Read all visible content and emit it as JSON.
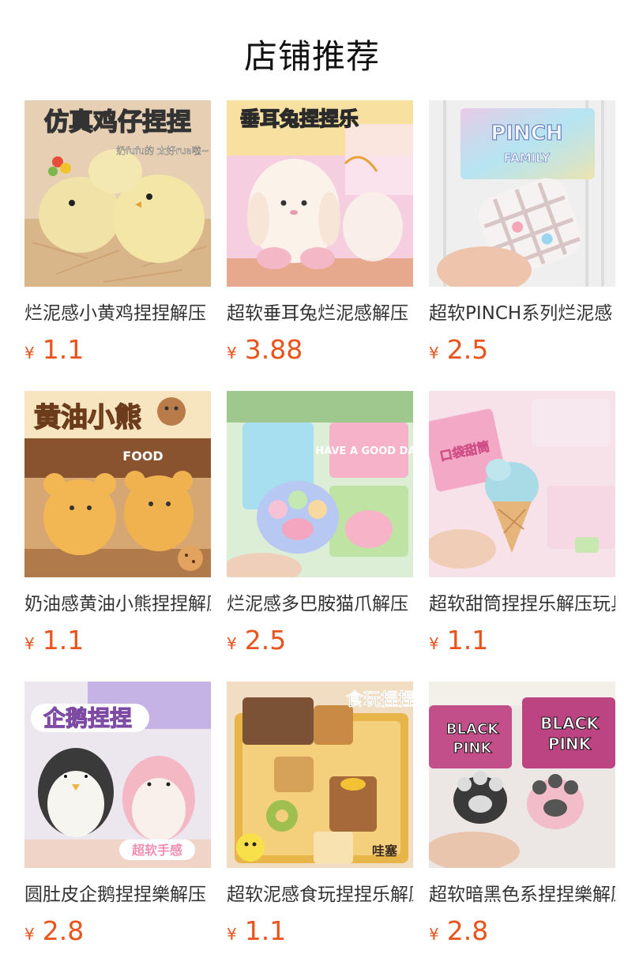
{
  "header": {
    "title": "店铺推荐"
  },
  "products": [
    {
      "name": "烂泥感小黄鸡捏捏解压",
      "currency": "¥",
      "price": "1.1",
      "image_text": [
        "仿真鸡仔捏捏",
        "奶fufu的 太好rua啦~"
      ],
      "theme": "chick",
      "bg": "#e9d2b6",
      "accent": "#f2e29a"
    },
    {
      "name": "超软垂耳兔烂泥感解压",
      "currency": "¥",
      "price": "3.88",
      "image_text": [
        "垂耳兔捏捏乐"
      ],
      "theme": "bunny",
      "bg": "#f4c9dc",
      "accent": "#fff6ef"
    },
    {
      "name": "超软PINCH系列烂泥感",
      "currency": "¥",
      "price": "2.5",
      "image_text": [
        "PINCH",
        "FAMILY"
      ],
      "theme": "waffle",
      "bg": "#ececec",
      "accent": "#b9d7f0"
    },
    {
      "name": "奶油感黄油小熊捏捏解压",
      "currency": "¥",
      "price": "1.1",
      "image_text": [
        "黄油小熊",
        "FOOD"
      ],
      "theme": "bear",
      "bg": "#c98a52",
      "accent": "#f0b04c"
    },
    {
      "name": "烂泥感多巴胺猫爪解压",
      "currency": "¥",
      "price": "2.5",
      "image_text": [
        "HAVE A GOOD DAY"
      ],
      "theme": "paw",
      "bg": "#d9ecd4",
      "accent": "#f3a6c4"
    },
    {
      "name": "超软甜筒捏捏乐解压玩具",
      "currency": "¥",
      "price": "1.1",
      "image_text": [
        "口袋甜筒"
      ],
      "theme": "icecream",
      "bg": "#f6dde6",
      "accent": "#a8d8e6"
    },
    {
      "name": "圆肚皮企鹅捏捏樂解压",
      "currency": "¥",
      "price": "2.8",
      "image_text": [
        "企鹅捏捏",
        "超软手感"
      ],
      "theme": "penguin",
      "bg": "#e6e0ea",
      "accent": "#f5b7c6"
    },
    {
      "name": "超软泥感食玩捏捏乐解压",
      "currency": "¥",
      "price": "1.1",
      "image_text": [
        "食玩捏捏",
        "哇塞"
      ],
      "theme": "food",
      "bg": "#e8b54a",
      "accent": "#f6d990"
    },
    {
      "name": "超软暗黑色系捏捏樂解压",
      "currency": "¥",
      "price": "2.8",
      "image_text": [
        "BLACK",
        "PINK"
      ],
      "theme": "blackpink",
      "bg": "#e7e2e1",
      "accent": "#c04a86"
    }
  ]
}
